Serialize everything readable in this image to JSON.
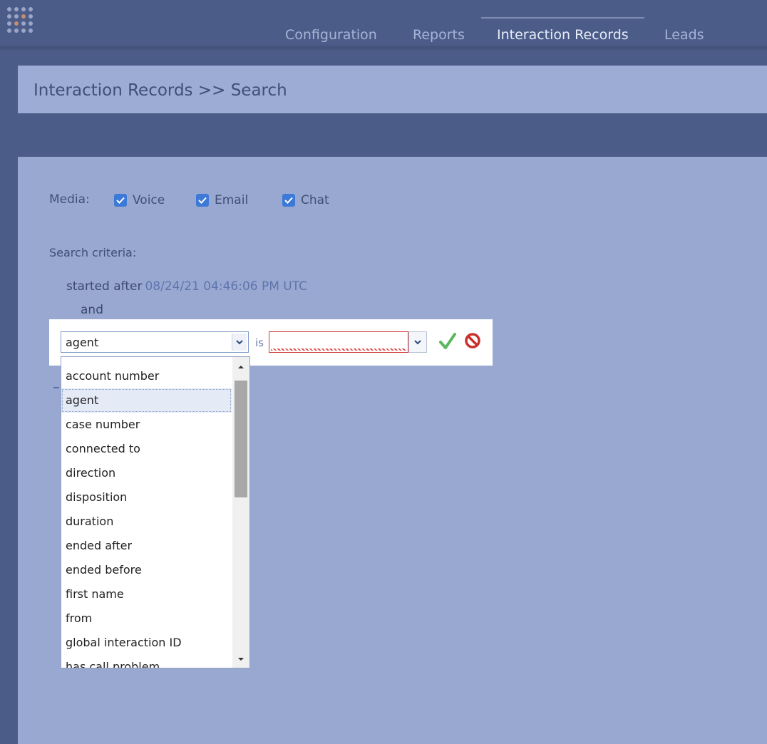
{
  "nav": {
    "items": [
      {
        "label": "Configuration",
        "active": false
      },
      {
        "label": "Reports",
        "active": false
      },
      {
        "label": "Interaction Records",
        "active": true
      },
      {
        "label": "Leads",
        "active": false
      }
    ]
  },
  "page": {
    "title": "Interaction Records >> Search"
  },
  "media": {
    "label": "Media:",
    "options": [
      {
        "label": "Voice",
        "checked": true
      },
      {
        "label": "Email",
        "checked": true
      },
      {
        "label": "Chat",
        "checked": true
      }
    ]
  },
  "criteria": {
    "label": "Search criteria:",
    "condition_text": "started after",
    "condition_value": "08/24/21 04:46:06 PM UTC",
    "conjunction": "and",
    "editor": {
      "field_value": "agent",
      "operator": "is",
      "value": ""
    }
  },
  "dropdown": {
    "options": [
      "account number",
      "agent",
      "case number",
      "connected to",
      "direction",
      "disposition",
      "duration",
      "ended after",
      "ended before",
      "first name",
      "from",
      "global interaction ID",
      "has call problem"
    ],
    "selected": "agent"
  },
  "colors": {
    "header_dark": "#4b5c88",
    "panel": "#98a8d1",
    "checkbox": "#3d79d6",
    "ok": "#5cb85c",
    "cancel": "#c9302c"
  }
}
